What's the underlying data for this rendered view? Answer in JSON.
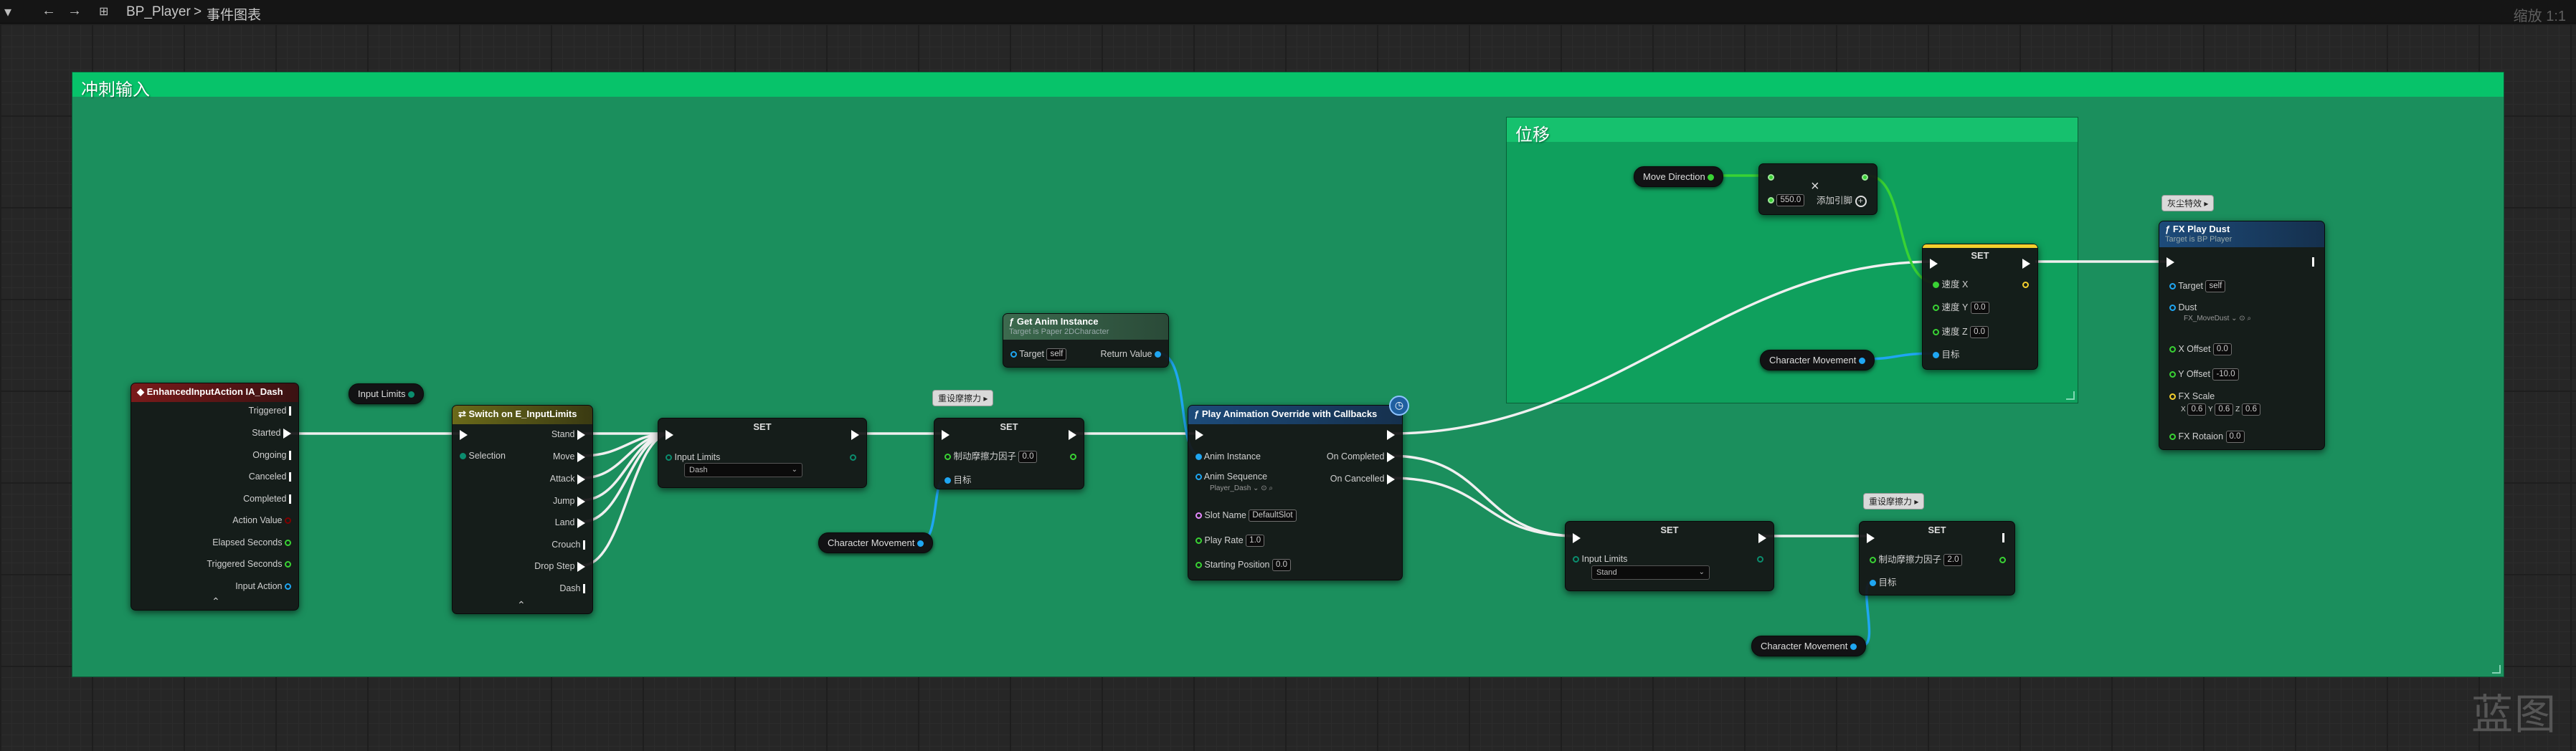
{
  "toolbar": {
    "back_icon": "←",
    "forward_icon": "→",
    "asset": "BP_Player",
    "separator": ">",
    "graph": "事件图表",
    "zoom": "缩放 1:1"
  },
  "watermark": "蓝图",
  "colors": {
    "comment_outer": "#1b8f5d",
    "comment_header": "#07c36a",
    "comment_inner": "#0fa05d",
    "comment_inner_header": "#16c16e",
    "exec": "#ffffff",
    "bool_pin": "#7e0000",
    "float_pin": "#39d234",
    "object_pin": "#1fa6f2",
    "struct_pin": "#f0a81a",
    "vector_pin": "#f4cf2d",
    "byte_pin": "#0b8d6e",
    "enum_node_header": "#5a5a1a",
    "event_header": "#7a1a1a",
    "function_header": "#1d4b7a",
    "pure_header": "#3c6a4e"
  },
  "comments": {
    "outer": "冲刺输入",
    "inner": "位移"
  },
  "nodes": {
    "enhanced_input": {
      "title": "EnhancedInputAction IA_Dash",
      "outputs": [
        "Triggered",
        "Started",
        "Ongoing",
        "Canceled",
        "Completed",
        "Action Value",
        "Elapsed Seconds",
        "Triggered Seconds",
        "Input Action"
      ]
    },
    "input_limits_get": {
      "label": "Input Limits"
    },
    "switch": {
      "title": "Switch on E_InputLimits",
      "input": "Selection",
      "outputs": [
        "Stand",
        "Move",
        "Attack",
        "Jump",
        "Land",
        "Crouch",
        "Drop Step",
        "Dash"
      ]
    },
    "set_input_limits_1": {
      "title": "SET",
      "pin": "Input Limits",
      "value": "Dash"
    },
    "reset_friction_bubble_1": "重设摩擦力",
    "set_friction_1": {
      "title": "SET",
      "pin": "制动摩擦力因子",
      "value": "0.0",
      "target": "目标"
    },
    "char_movement_1": "Character Movement",
    "get_anim_instance": {
      "title": "Get Anim Instance",
      "subtitle": "Target is Paper 2DCharacter",
      "target": "Target",
      "target_value": "self",
      "output": "Return Value"
    },
    "play_anim": {
      "title": "Play Animation Override with Callbacks",
      "anim_instance": "Anim Instance",
      "anim_sequence": "Anim Sequence",
      "anim_sequence_value": "Player_Dash",
      "slot_name": "Slot Name",
      "slot_value": "DefaultSlot",
      "play_rate": "Play Rate",
      "play_rate_value": "1.0",
      "start_pos": "Starting Position",
      "start_pos_value": "0.0",
      "on_completed": "On Completed",
      "on_cancelled": "On Cancelled"
    },
    "move_direction": "Move Direction",
    "multiply": {
      "symbol": "×",
      "value": "550.0",
      "add_pin": "添加引脚"
    },
    "set_velocity": {
      "title": "SET",
      "x": "速度 X",
      "y": "速度 Y",
      "y_value": "0.0",
      "z": "速度 Z",
      "z_value": "0.0",
      "target": "目标"
    },
    "char_movement_2": "Character Movement",
    "dust_bubble": "灰尘特效",
    "fx_play_dust": {
      "title": "FX Play Dust",
      "subtitle": "Target is BP Player",
      "target": "Target",
      "target_value": "self",
      "dust": "Dust",
      "dust_value": "FX_MoveDust",
      "x_offset": "X Offset",
      "x_offset_value": "0.0",
      "y_offset": "Y Offset",
      "y_offset_value": "-10.0",
      "fx_scale": "FX Scale",
      "scale_x": "0.6",
      "scale_y": "0.6",
      "scale_z": "0.6",
      "fx_rotation": "FX Rotaion",
      "fx_rotation_value": "0.0"
    },
    "set_input_limits_2": {
      "title": "SET",
      "pin": "Input Limits",
      "value": "Stand"
    },
    "reset_friction_bubble_2": "重设摩擦力",
    "set_friction_2": {
      "title": "SET",
      "pin": "制动摩擦力因子",
      "value": "2.0",
      "target": "目标"
    },
    "char_movement_3": "Character Movement"
  }
}
